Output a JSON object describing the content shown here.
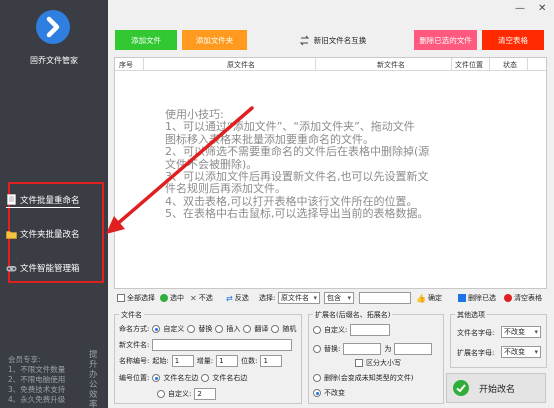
{
  "app": {
    "name": "固乔文件管家",
    "window_controls": [
      "—",
      "✕"
    ]
  },
  "sidebar": {
    "items": [
      {
        "label": "文件批量重命名",
        "icon": "document-icon",
        "active": true
      },
      {
        "label": "文件夹批量改名",
        "icon": "folder-icon",
        "active": false
      },
      {
        "label": "文件智能管理箱",
        "icon": "gamepad-icon",
        "active": false
      }
    ],
    "member_note": [
      "会员专享:",
      "1、不限文件数量",
      "2、不限电脑使用",
      "3、免费技术支持",
      "4、永久免费升级"
    ],
    "vertical_note": "提升办公效率"
  },
  "toolbar": {
    "add_file": "添加文件",
    "add_folder": "添加文件夹",
    "swap_names": "新旧文件名互换",
    "delete_selected": "删除已选的文件",
    "clear_table": "清空表格"
  },
  "table": {
    "columns": [
      "序号",
      "原文件名",
      "新文件名",
      "文件位置",
      "状态"
    ],
    "tips": [
      "使用小技巧:",
      "1、可以通过“添加文件”、“添加文件夹”、拖动文件",
      "图标移入表格来批量添加要重命名的文件。",
      "2、可以筛选不需要重命名的文件后在表格中删除掉(源",
      "文件不会被删除)。",
      "3、可以添加文件后再设置新文件名,也可以先设置新文",
      "件名规则后再添加文件。",
      "4、双击表格,可以打开表格中该行文件所在的位置。",
      "5、在表格中右击鼠标,可以选择导出当前的表格数据。"
    ]
  },
  "selection_bar": {
    "select_all": "全部选择",
    "select": "选中",
    "unselect": "不选",
    "invert": "反选",
    "choose_label": "选择:",
    "field_select": "原文件名",
    "match_select": "包含",
    "confirm": "确定",
    "delete_selected": "删除已选",
    "clear_table": "清空表格"
  },
  "filename_group": {
    "title": "文件名",
    "mode_label": "命名方式:",
    "modes": [
      "自定义",
      "替换",
      "插入",
      "翻译",
      "随机"
    ],
    "new_name_label": "新文件名:",
    "number_label": "名称编号:",
    "start_label": "起始:",
    "start_value": "1",
    "step_label": "增量:",
    "step_value": "1",
    "digits_label": "位数:",
    "digits_value": "1",
    "position_label": "编号位置:",
    "positions": [
      "文件名左边",
      "文件名右边",
      "自定义:"
    ],
    "custom_pos_value": "2"
  },
  "ext_group": {
    "title": "扩展名(后缀名、拓展名)",
    "custom_label": "自定义:",
    "replace_label": "替换:",
    "as_label": "为",
    "case_label": "区分大小写",
    "delete_label": "删除(会变成未知类型的文件)",
    "unchanged_label": "不改变"
  },
  "other_group": {
    "title": "其他选项",
    "filename_case_label": "文件名字母:",
    "filename_case_value": "不改变",
    "ext_case_label": "扩展名字母:",
    "ext_case_value": "不改变"
  },
  "start_button": "开始改名",
  "colors": {
    "sidebar_bg": "#3a3e44",
    "add_file": "#32c832",
    "add_folder": "#ff9a1e",
    "delete": "#ff5a7d",
    "clear": "#ff2a00",
    "highlight_red": "#e02020"
  }
}
